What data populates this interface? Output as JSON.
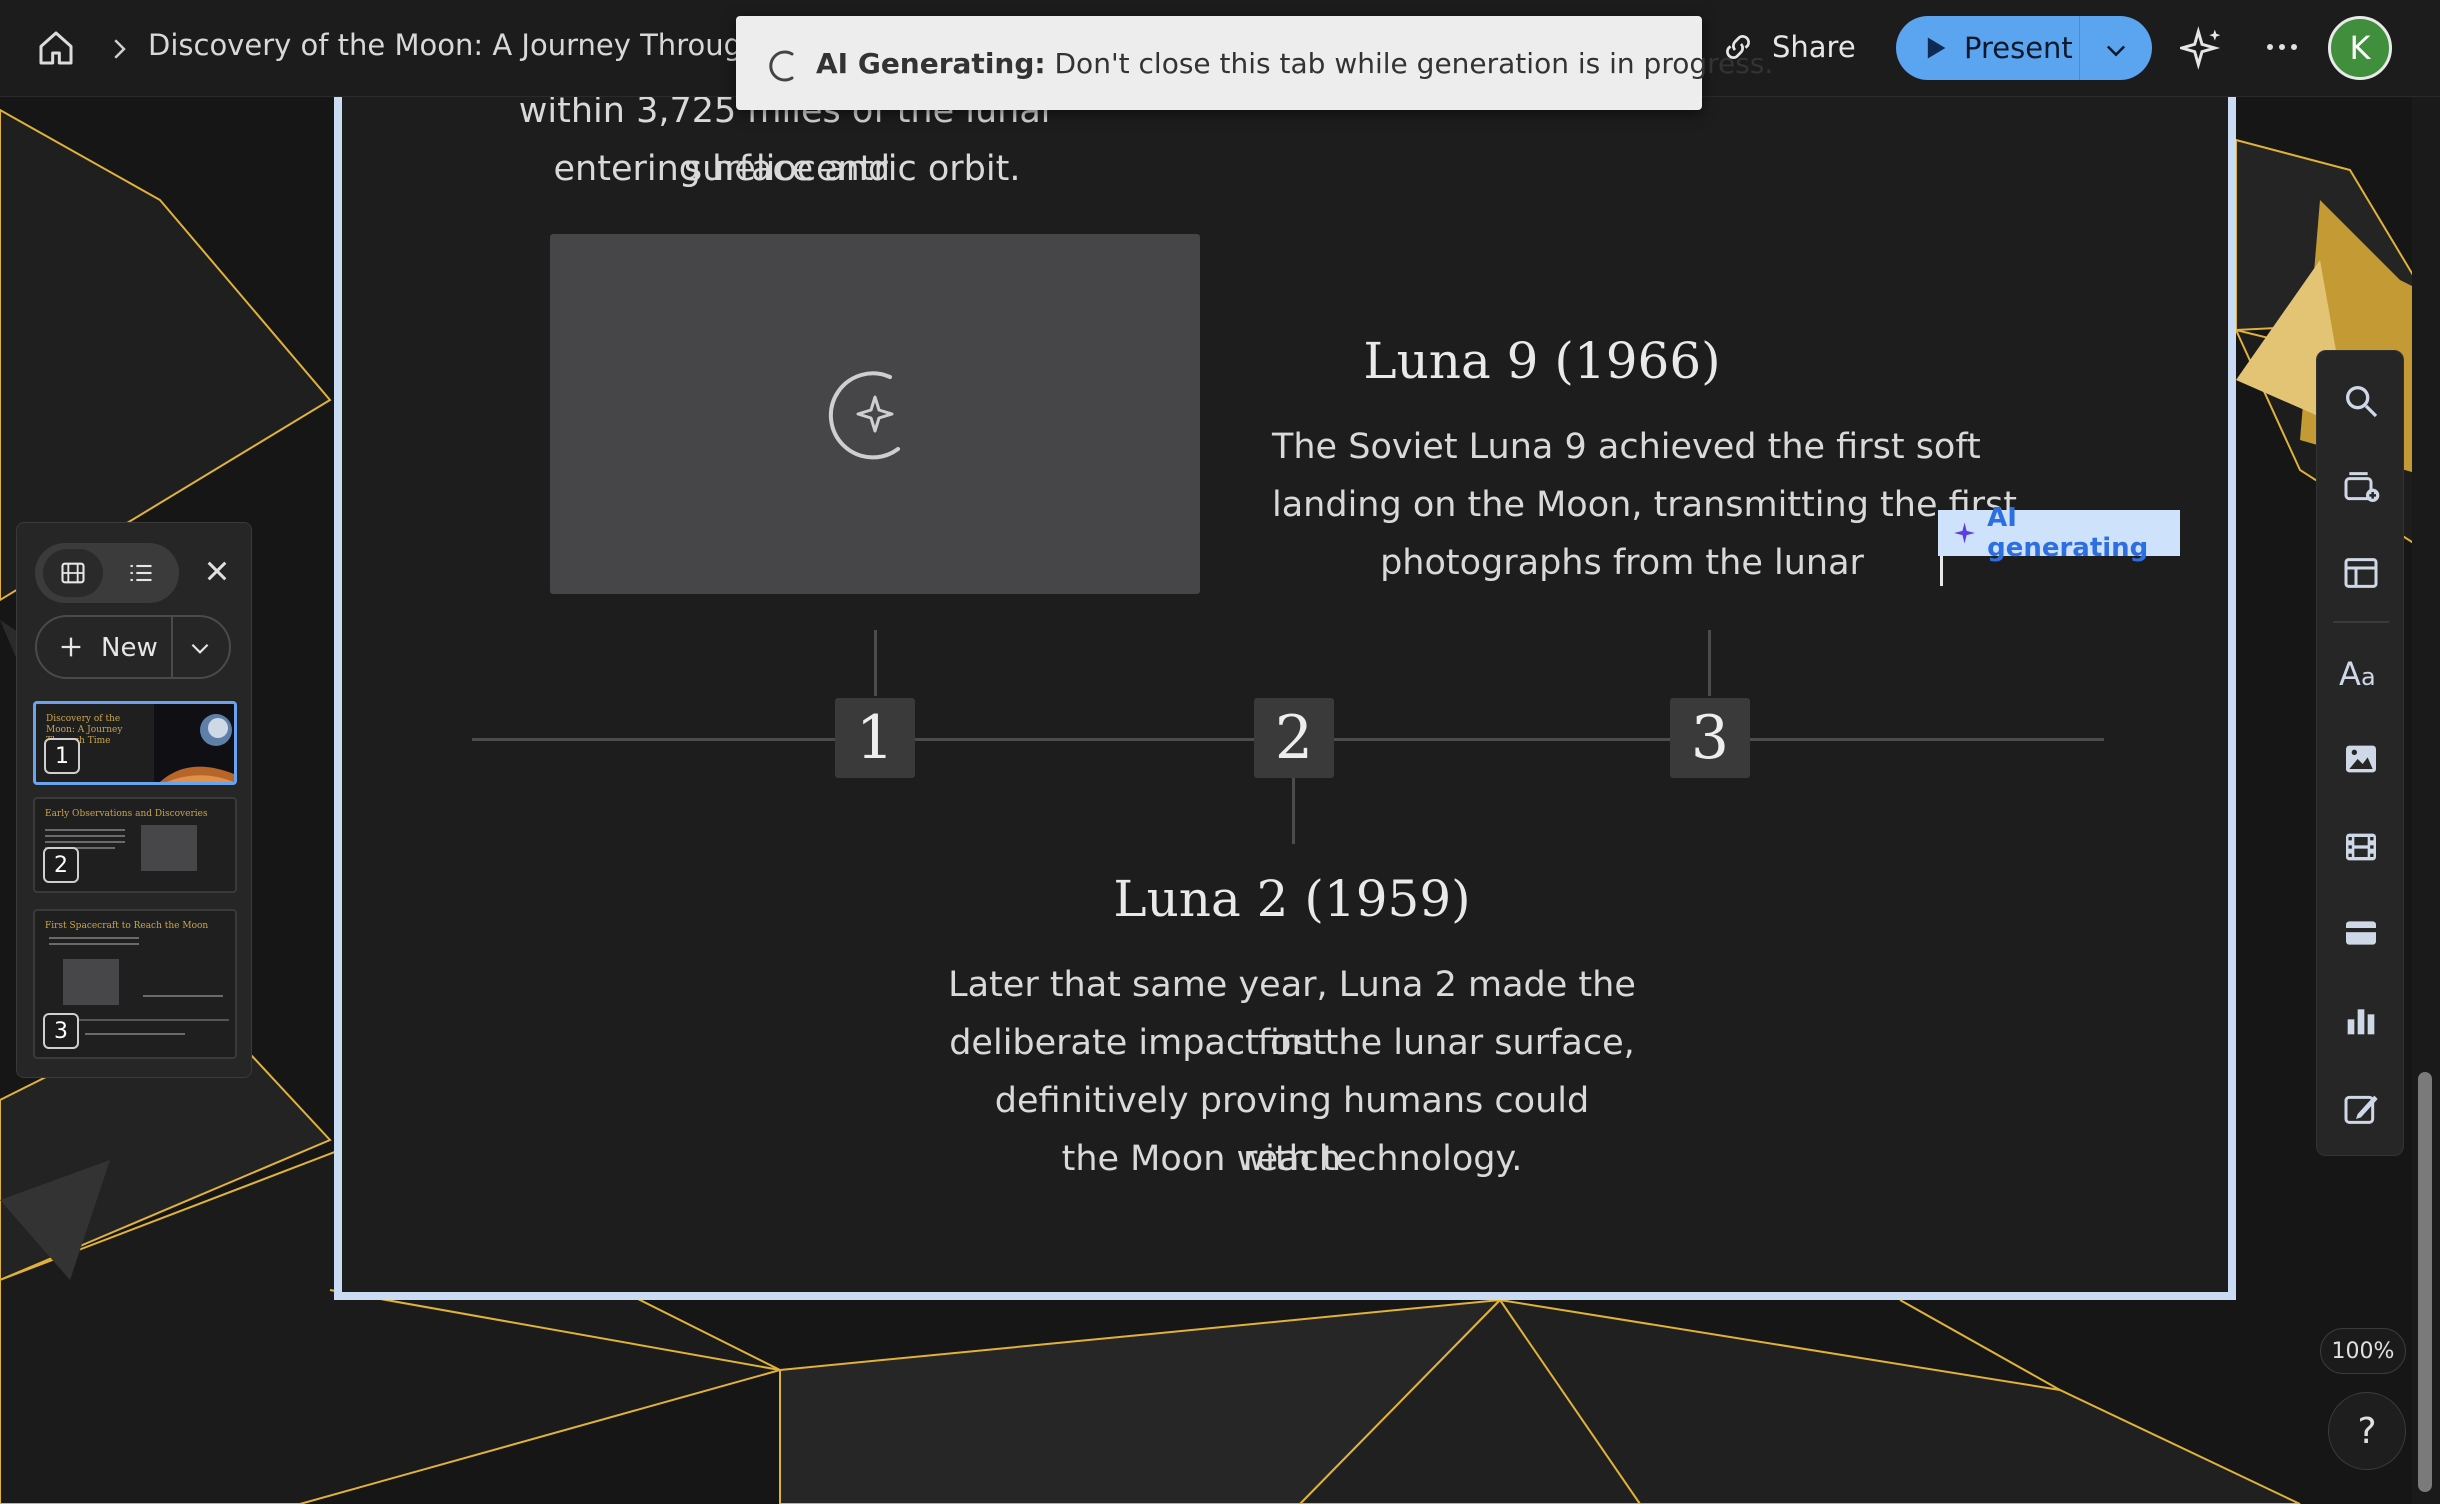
{
  "topbar": {
    "doc_title": "Discovery of the Moon: A Journey Through ...",
    "share_label": "Share",
    "present_label": "Present",
    "avatar_initial": "K"
  },
  "toast": {
    "bold": "AI Generating:",
    "message": "Don't close this tab while generation is in progress."
  },
  "slide": {
    "top_text_line1": "within 3,725 miles of the lunar surface and",
    "top_text_line2": "entering heliocentric orbit.",
    "luna9_title": "Luna 9 (1966)",
    "luna9_line1": "The Soviet Luna 9 achieved the first soft",
    "luna9_line2": "landing on the Moon, transmitting the first",
    "luna9_line3": "photographs from the lunar",
    "ai_tag": "AI generating",
    "markers": [
      "1",
      "2",
      "3"
    ],
    "luna2_title": "Luna 2 (1959)",
    "luna2_line1": "Later that same year, Luna 2 made the first",
    "luna2_line2": "deliberate impact on the lunar surface,",
    "luna2_line3": "definitively proving humans could reach",
    "luna2_line4": "the Moon with technology."
  },
  "panel": {
    "new_label": "New",
    "thumbs": [
      {
        "num": "1",
        "title": "Discovery of the Moon: A Journey Through Time"
      },
      {
        "num": "2",
        "title": "Early Observations and Discoveries"
      },
      {
        "num": "3",
        "title": "First Spacecraft to Reach the Moon"
      }
    ]
  },
  "zoom": "100%",
  "help": "?",
  "colors": {
    "accent": "#5aa4f0",
    "gold": "#e6b93a",
    "slide_bg": "#1d1d1d",
    "selection_border": "#c9dcf3"
  }
}
